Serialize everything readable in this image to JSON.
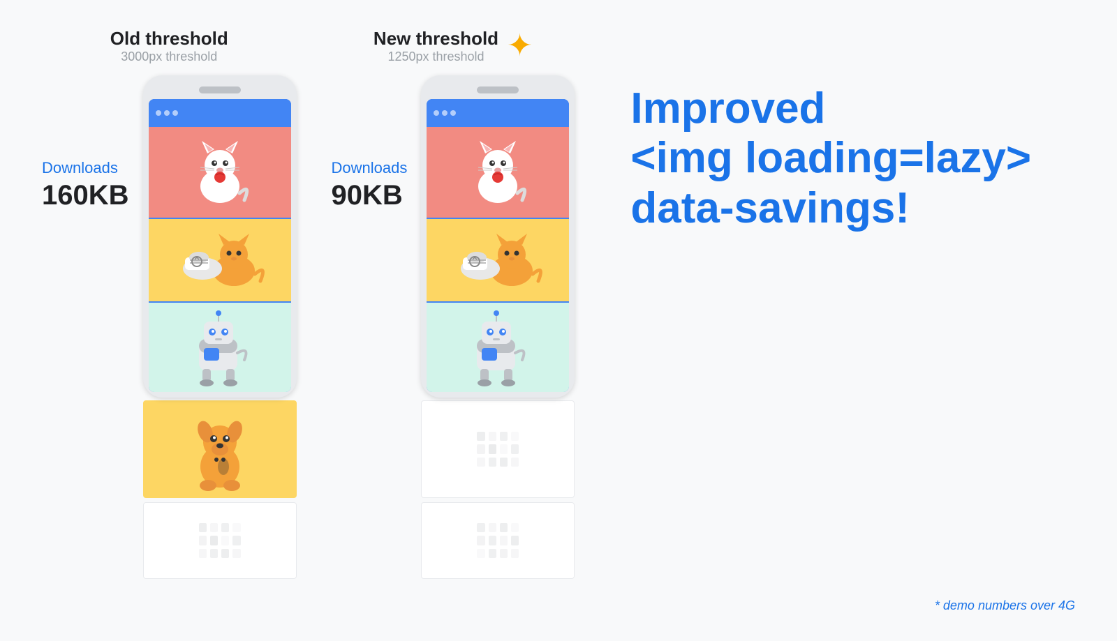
{
  "page": {
    "background": "#f8f9fa"
  },
  "left_threshold": {
    "title": "Old threshold",
    "subtitle": "3000px threshold",
    "downloads_label": "Downloads",
    "downloads_size": "160KB"
  },
  "right_threshold": {
    "title": "New threshold",
    "subtitle": "1250px threshold",
    "downloads_label": "Downloads",
    "downloads_size": "90KB",
    "sparkle": "✦"
  },
  "description": {
    "line1": "Improved",
    "line2": "<img loading=lazy>",
    "line3": "data-savings!"
  },
  "demo_note": "* demo numbers over 4G",
  "accent_color": "#1a73e8"
}
